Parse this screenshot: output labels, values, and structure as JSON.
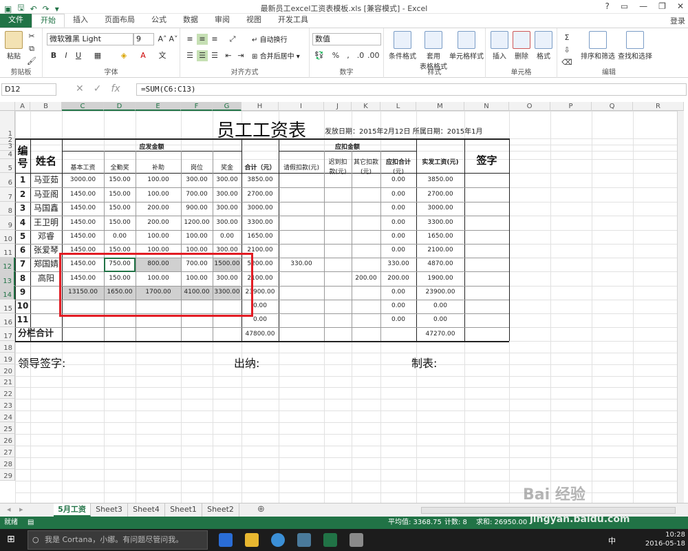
{
  "window": {
    "title": "最新员工excel工资表模板.xls  [兼容模式] - Excel",
    "login": "登录"
  },
  "ribbon": {
    "tabs": [
      "文件",
      "开始",
      "插入",
      "页面布局",
      "公式",
      "数据",
      "审阅",
      "视图",
      "开发工具"
    ],
    "paste": "粘贴",
    "font_name": "微软雅黑 Light",
    "font_size": "9",
    "wrap_text": "自动换行",
    "merge_center": "合并后居中",
    "number_format": "数值",
    "cond_format": "条件格式",
    "table_format_1": "套用",
    "table_format_2": "表格格式",
    "cell_style": "单元格样式",
    "insert": "插入",
    "delete": "删除",
    "format": "格式",
    "sort_filter": "排序和筛选",
    "find_select": "查找和选择",
    "groups": [
      "剪贴板",
      "字体",
      "对齐方式",
      "数字",
      "样式",
      "单元格",
      "编辑"
    ]
  },
  "formula_bar": {
    "name_box": "D12",
    "formula": "=SUM(C6:C13)"
  },
  "columns": [
    "A",
    "B",
    "C",
    "D",
    "E",
    "F",
    "G",
    "H",
    "I",
    "J",
    "K",
    "L",
    "M",
    "N",
    "O",
    "P",
    "Q",
    "R"
  ],
  "rows": [
    "1",
    "2",
    "3",
    "4",
    "5",
    "6",
    "7",
    "8",
    "9",
    "10",
    "11",
    "12",
    "13",
    "14",
    "15",
    "16",
    "17",
    "18",
    "19",
    "20",
    "21",
    "22",
    "23",
    "24",
    "25",
    "26",
    "27",
    "28",
    "29"
  ],
  "sheet": {
    "title": "员工工资表",
    "subtitle": "发放日期：2015年2月12日 所属日期：2015年1月",
    "h_no": "编号",
    "h_name": "姓名",
    "h_payable": "应发金额",
    "h_deduct": "应扣金额",
    "h_actual": "实发工资(元)",
    "h_sign": "签字",
    "h_base": "基本工资",
    "h_attend": "全勤奖",
    "h_subsidy": "补助",
    "h_post": "岗位",
    "h_bonus": "奖金",
    "h_total": "合计（元）",
    "h_leave": "请假扣款(元)",
    "h_late_1": "迟到扣",
    "h_late_2": "款(元)",
    "h_other_1": "其它扣款",
    "h_other_2": "(元)",
    "h_dtotal_1": "应扣合计",
    "h_dtotal_2": "(元)",
    "rows": [
      {
        "no": "1",
        "name": "马亚茹",
        "c": "3000.00",
        "d": "150.00",
        "e": "100.00",
        "f": "300.00",
        "g": "300.00",
        "h": "3850.00",
        "i": "",
        "j": "",
        "k": "",
        "l": "0.00",
        "m": "3850.00"
      },
      {
        "no": "2",
        "name": "马亚阁",
        "c": "1450.00",
        "d": "150.00",
        "e": "100.00",
        "f": "700.00",
        "g": "300.00",
        "h": "2700.00",
        "i": "",
        "j": "",
        "k": "",
        "l": "0.00",
        "m": "2700.00"
      },
      {
        "no": "3",
        "name": "马国鑫",
        "c": "1450.00",
        "d": "150.00",
        "e": "200.00",
        "f": "900.00",
        "g": "300.00",
        "h": "3000.00",
        "i": "",
        "j": "",
        "k": "",
        "l": "0.00",
        "m": "3000.00"
      },
      {
        "no": "4",
        "name": "王卫明",
        "c": "1450.00",
        "d": "150.00",
        "e": "200.00",
        "f": "1200.00",
        "g": "300.00",
        "h": "3300.00",
        "i": "",
        "j": "",
        "k": "",
        "l": "0.00",
        "m": "3300.00"
      },
      {
        "no": "5",
        "name": "邓睿",
        "c": "1450.00",
        "d": "0.00",
        "e": "100.00",
        "f": "100.00",
        "g": "0.00",
        "h": "1650.00",
        "i": "",
        "j": "",
        "k": "",
        "l": "0.00",
        "m": "1650.00"
      },
      {
        "no": "6",
        "name": "张爱琴",
        "c": "1450.00",
        "d": "150.00",
        "e": "100.00",
        "f": "100.00",
        "g": "300.00",
        "h": "2100.00",
        "i": "",
        "j": "",
        "k": "",
        "l": "0.00",
        "m": "2100.00"
      },
      {
        "no": "7",
        "name": "郑国婧",
        "c": "1450.00",
        "d": "750.00",
        "e": "800.00",
        "f": "700.00",
        "g": "1500.00",
        "h": "5200.00",
        "i": "330.00",
        "j": "",
        "k": "",
        "l": "330.00",
        "m": "4870.00"
      },
      {
        "no": "8",
        "name": "高阳",
        "c": "1450.00",
        "d": "150.00",
        "e": "100.00",
        "f": "100.00",
        "g": "300.00",
        "h": "2100.00",
        "i": "",
        "j": "",
        "k": "200.00",
        "l": "200.00",
        "m": "1900.00"
      },
      {
        "no": "9",
        "name": "",
        "c": "13150.00",
        "d": "1650.00",
        "e": "1700.00",
        "f": "4100.00",
        "g": "3300.00",
        "h": "23900.00",
        "i": "",
        "j": "",
        "k": "",
        "l": "0.00",
        "m": "23900.00"
      },
      {
        "no": "10",
        "name": "",
        "c": "",
        "d": "",
        "e": "",
        "f": "",
        "g": "",
        "h": "0.00",
        "i": "",
        "j": "",
        "k": "",
        "l": "0.00",
        "m": "0.00"
      },
      {
        "no": "11",
        "name": "",
        "c": "",
        "d": "",
        "e": "",
        "f": "",
        "g": "",
        "h": "0.00",
        "i": "",
        "j": "",
        "k": "",
        "l": "0.00",
        "m": "0.00"
      }
    ],
    "subtotal_label": "分栏合计",
    "subtotal_h": "47800.00",
    "subtotal_m": "47270.00",
    "leader_sign": "领导签字:",
    "cashier": "出纳:",
    "preparer": "制表:"
  },
  "sheet_tabs": [
    "5月工资",
    "Sheet3",
    "Sheet4",
    "Sheet1",
    "Sheet2"
  ],
  "status": {
    "ready": "就绪",
    "average": "平均值: 3368.75",
    "count": "计数: 8",
    "sum": "求和: 26950.00"
  },
  "taskbar": {
    "cortana": "我是 Cortana，小娜。有问题尽管问我。",
    "ime": "中",
    "time": "10:28",
    "date": "2016-05-18"
  },
  "watermark": {
    "text1": "Bai 经验",
    "text2": "jingyan.baidu.com"
  }
}
